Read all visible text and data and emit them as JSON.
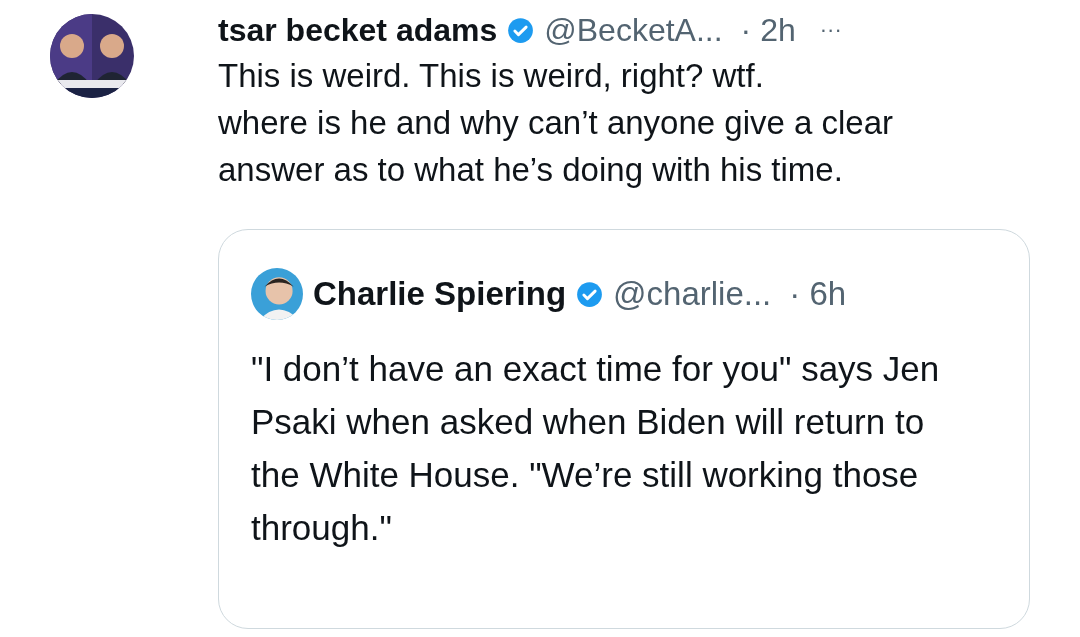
{
  "tweet": {
    "author_name": "tsar becket adams",
    "verified": true,
    "handle": "@BecketA...",
    "time": "· 2h",
    "more": "···",
    "text": "This is weird. This is weird, right? wtf.\nwhere is he and why can’t anyone give a clear answer as to what he’s doing with his time.",
    "quote": {
      "author_name": "Charlie Spiering",
      "verified": true,
      "handle": "@charlie...",
      "time": "· 6h",
      "text": "\"I don’t have an exact time for you\" says Jen Psaki when asked when Biden will return to the White House. \"We’re still working those through.\""
    }
  }
}
